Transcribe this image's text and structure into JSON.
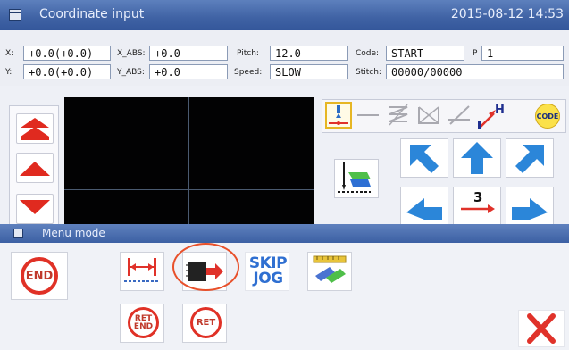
{
  "title": "Coordinate input",
  "datetime": "2015-08-12 14:53",
  "fields": {
    "x_label": "X:",
    "x_value": "+0.0(+0.0)",
    "y_label": "Y:",
    "y_value": "+0.0(+0.0)",
    "xabs_label": "X_ABS:",
    "xabs_value": "+0.0",
    "yabs_label": "Y_ABS:",
    "yabs_value": "+0.0",
    "pitch_label": "Pitch:",
    "pitch_value": "12.0",
    "speed_label": "Speed:",
    "speed_value": "SLOW",
    "code_label": "Code:",
    "code_value": "START",
    "p_label": "P",
    "p_value": "1",
    "stitch_label": "Stitch:",
    "stitch_value": "00000/00000"
  },
  "toolbar": {
    "code_label": "CODE"
  },
  "direction": {
    "step_value": "3"
  },
  "menu": {
    "title": "Menu mode",
    "end_label": "END",
    "ret_end_top": "RET",
    "ret_end_bottom": "END",
    "ret_label": "RET",
    "skip_label": "SKIP",
    "jog_label": "JOG"
  },
  "colors": {
    "title_bar": "#3f62a4",
    "accent_red": "#e03126",
    "arrow_blue": "#2b86d9"
  }
}
